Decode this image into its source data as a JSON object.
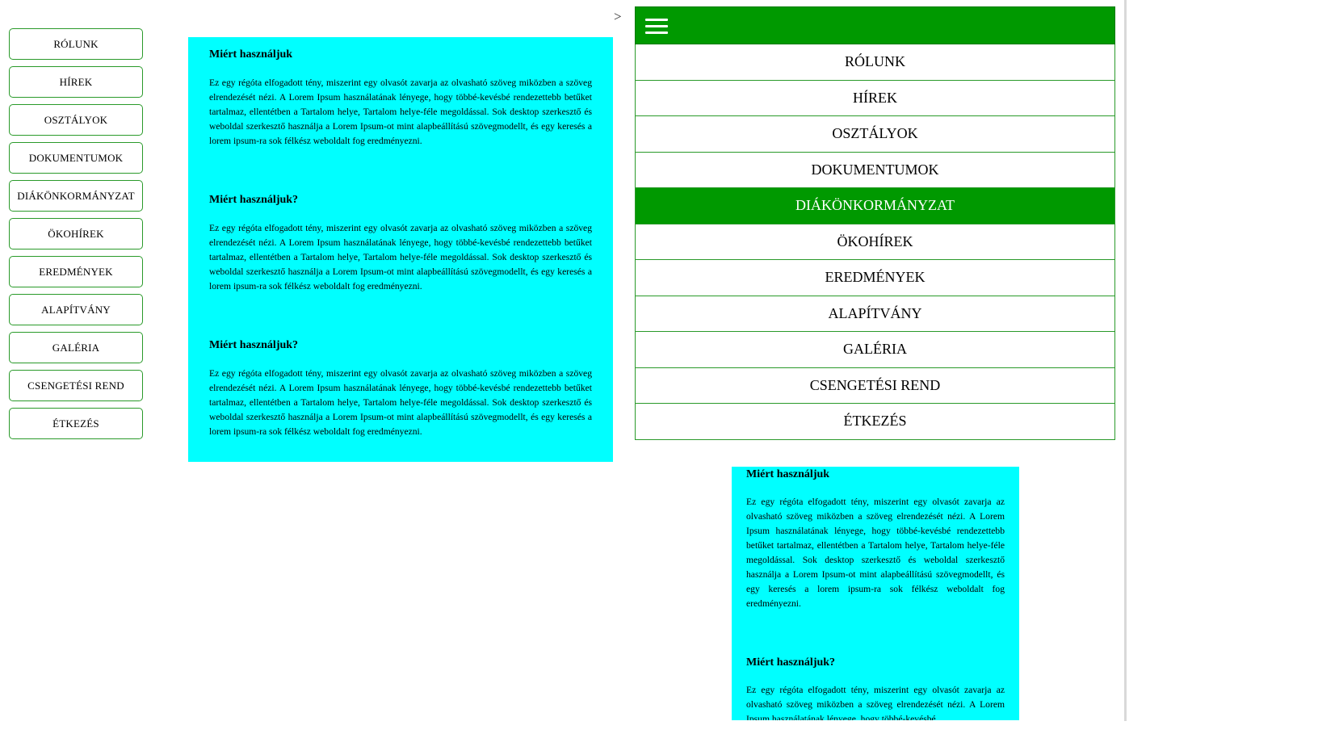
{
  "left_nav": {
    "items": [
      {
        "label": "RÓLUNK"
      },
      {
        "label": "HÍREK"
      },
      {
        "label": "OSZTÁLYOK"
      },
      {
        "label": "DOKUMENTUMOK"
      },
      {
        "label": "DIÁKÖNKORMÁNYZAT"
      },
      {
        "label": "ÖKOHÍREK"
      },
      {
        "label": "EREDMÉNYEK"
      },
      {
        "label": "ALAPÍTVÁNY"
      },
      {
        "label": "GALÉRIA"
      },
      {
        "label": "CSENGETÉSI REND"
      },
      {
        "label": "ÉTKEZÉS"
      }
    ]
  },
  "arrow_glyph": ">",
  "panel_1": {
    "articles": [
      {
        "title": "Miért használjuk",
        "body": "Ez egy régóta elfogadott tény, miszerint egy olvasót zavarja az olvasható szöveg miközben a szöveg elrendezését nézi. A Lorem Ipsum használatának lényege, hogy többé-kevésbé rendezettebb betűket tartalmaz, ellentétben a Tartalom helye, Tartalom helye-féle megoldással. Sok desktop szerkesztő és weboldal szerkesztő használja a Lorem Ipsum-ot mint alapbeállítású szövegmodellt, és egy keresés a lorem ipsum-ra sok félkész weboldalt fog eredményezni."
      },
      {
        "title": "Miért használjuk?",
        "body": "Ez egy régóta elfogadott tény, miszerint egy olvasót zavarja az olvasható szöveg miközben a szöveg elrendezését nézi. A Lorem Ipsum használatának lényege, hogy többé-kevésbé rendezettebb betűket tartalmaz, ellentétben a Tartalom helye, Tartalom helye-féle megoldással. Sok desktop szerkesztő és weboldal szerkesztő használja a Lorem Ipsum-ot mint alapbeállítású szövegmodellt, és egy keresés a lorem ipsum-ra sok félkész weboldalt fog eredményezni."
      },
      {
        "title": "Miért használjuk?",
        "body": "Ez egy régóta elfogadott tény, miszerint egy olvasót zavarja az olvasható szöveg miközben a szöveg elrendezését nézi. A Lorem Ipsum használatának lényege, hogy többé-kevésbé rendezettebb betűket tartalmaz, ellentétben a Tartalom helye, Tartalom helye-féle megoldással. Sok desktop szerkesztő és weboldal szerkesztő használja a Lorem Ipsum-ot mint alapbeállítású szövegmodellt, és egy keresés a lorem ipsum-ra sok félkész weboldalt fog eredményezni."
      }
    ]
  },
  "mobile_menu": {
    "hamburger_icon": "hamburger-menu-icon",
    "items": [
      {
        "label": "RÓLUNK"
      },
      {
        "label": "HÍREK"
      },
      {
        "label": "OSZTÁLYOK"
      },
      {
        "label": "DOKUMENTUMOK"
      },
      {
        "label": "DIÁKÖNKORMÁNYZAT"
      },
      {
        "label": "ÖKOHÍREK"
      },
      {
        "label": "EREDMÉNYEK"
      },
      {
        "label": "ALAPÍTVÁNY"
      },
      {
        "label": "GALÉRIA"
      },
      {
        "label": "CSENGETÉSI REND"
      },
      {
        "label": "ÉTKEZÉS"
      }
    ],
    "active_item": "DIÁKÖNKORMÁNYZAT"
  },
  "panel_2": {
    "articles": [
      {
        "title": "Miért használjuk",
        "body": "Ez egy régóta elfogadott tény, miszerint egy olvasót zavarja az olvasható szöveg miközben a szöveg elrendezését nézi. A Lorem Ipsum használatának lényege, hogy többé-kevésbé rendezettebb betűket tartalmaz, ellentétben a Tartalom helye, Tartalom helye-féle megoldással. Sok desktop szerkesztő és weboldal szerkesztő használja a Lorem Ipsum-ot mint alapbeállítású szövegmodellt, és egy keresés a lorem ipsum-ra sok félkész weboldalt fog eredményezni."
      },
      {
        "title": "Miért használjuk?",
        "body": "Ez egy régóta elfogadott tény, miszerint egy olvasót zavarja az olvasható szöveg miközben a szöveg elrendezését nézi. A Lorem Ipsum használatának lényege, hogy többé-kevésbé"
      }
    ]
  },
  "colors": {
    "green": "#009900",
    "cyan": "#00ffff",
    "border_green": "#2a9a2a"
  }
}
